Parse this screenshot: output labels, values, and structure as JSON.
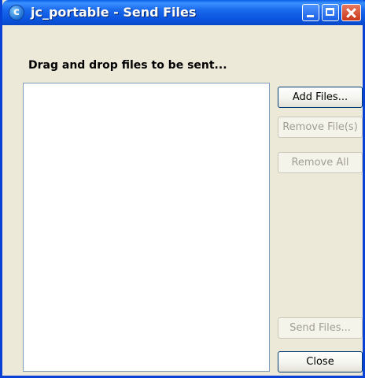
{
  "window": {
    "title": "jc_portable - Send Files",
    "app_icon_letter": "c"
  },
  "main": {
    "instruction": "Drag and drop files to be sent..."
  },
  "buttons": {
    "add_files": "Add Files...",
    "remove_files": "Remove File(s)",
    "remove_all": "Remove All",
    "send_files": "Send Files...",
    "close": "Close"
  },
  "colors": {
    "titlebar": "#0a55df",
    "window_bg": "#ece9d8",
    "list_border": "#7f9db9"
  }
}
